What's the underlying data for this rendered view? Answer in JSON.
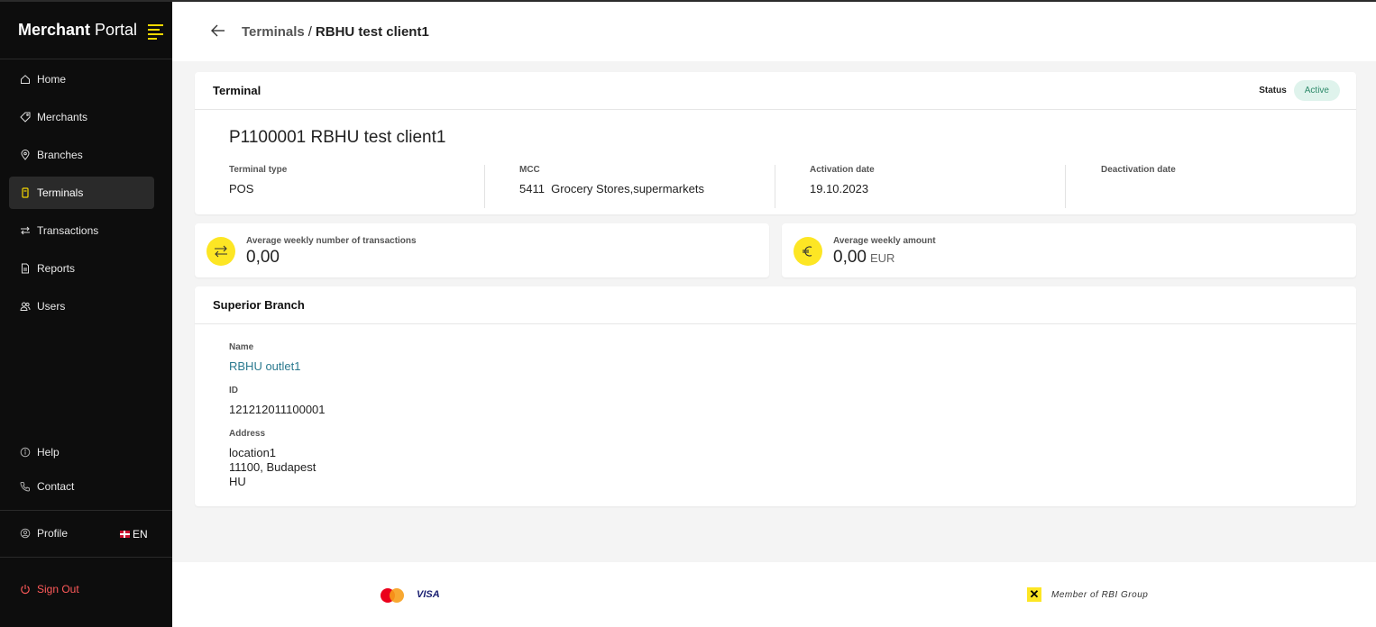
{
  "app": {
    "brand_bold": "Merchant",
    "brand_light": "Portal"
  },
  "sidebar": {
    "items": [
      {
        "label": "Home",
        "icon": "home-icon"
      },
      {
        "label": "Merchants",
        "icon": "tag-icon"
      },
      {
        "label": "Branches",
        "icon": "location-pin-icon"
      },
      {
        "label": "Terminals",
        "icon": "terminal-icon",
        "active": true
      },
      {
        "label": "Transactions",
        "icon": "arrows-exchange-icon"
      },
      {
        "label": "Reports",
        "icon": "document-icon"
      },
      {
        "label": "Users",
        "icon": "users-icon"
      }
    ],
    "help": "Help",
    "contact": "Contact",
    "profile": "Profile",
    "language": "EN",
    "sign_out": "Sign Out"
  },
  "header": {
    "breadcrumb_parent": "Terminals",
    "breadcrumb_sep": "/",
    "breadcrumb_current": "RBHU test client1"
  },
  "terminal_card": {
    "header": "Terminal",
    "status_label": "Status",
    "status_value": "Active",
    "title": "P1100001 RBHU test client1",
    "fields": [
      {
        "label": "Terminal type",
        "value": "POS"
      },
      {
        "label": "MCC",
        "value": "5411  Grocery Stores,supermarkets"
      },
      {
        "label": "Activation date",
        "value": "19.10.2023"
      },
      {
        "label": "Deactivation date",
        "value": ""
      }
    ]
  },
  "stats": {
    "transactions": {
      "label": "Average weekly number of transactions",
      "value": "0,00",
      "icon": "arrows-exchange-icon"
    },
    "amount": {
      "label": "Average weekly amount",
      "value": "0,00",
      "unit": "EUR",
      "icon": "euro-icon"
    }
  },
  "branch_card": {
    "header": "Superior Branch",
    "name_label": "Name",
    "name_value": "RBHU outlet1",
    "id_label": "ID",
    "id_value": "121212011100001",
    "address_label": "Address",
    "address_line1": "location1",
    "address_line2": "11100, Budapest",
    "address_line3": "HU"
  },
  "footer": {
    "card_brand_2": "VISA",
    "rbi_text": "Member of RBI Group"
  },
  "colors": {
    "accent": "#fde624",
    "sidebar_bg": "#0d0d0d",
    "status_bg": "#dff3ec",
    "status_fg": "#2e8a6a",
    "link": "#2b7a8f",
    "sign_out": "#ff5a5a"
  }
}
